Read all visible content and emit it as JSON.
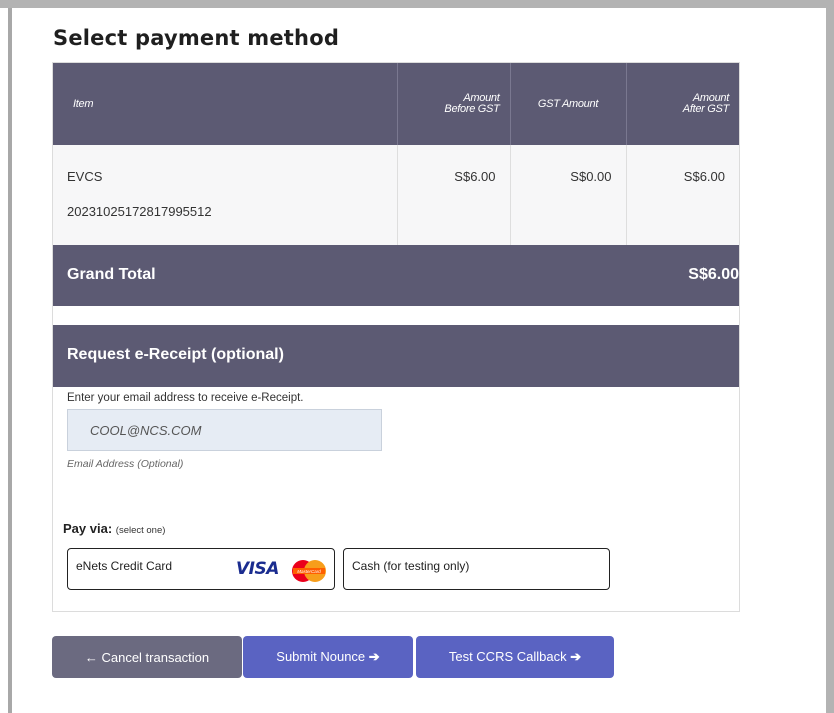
{
  "page": {
    "title": "Select payment method"
  },
  "table": {
    "headers": {
      "item": "Item",
      "before_gst_line1": "Amount",
      "before_gst_line2": "Before GST",
      "gst": "GST Amount",
      "after_gst_line1": "Amount",
      "after_gst_line2": "After GST"
    },
    "rows": [
      {
        "item": "EVCS",
        "reference": "20231025172817995512",
        "before_gst": "S$6.00",
        "gst": "S$0.00",
        "after_gst": "S$6.00"
      }
    ]
  },
  "grand_total": {
    "label": "Grand Total",
    "value": "S$6.00"
  },
  "receipt": {
    "heading": "Request e-Receipt (optional)",
    "help_text": "Enter your email address to receive e-Receipt.",
    "email_value": "COOL@NCS.COM",
    "caption": "Email Address (Optional)"
  },
  "payment": {
    "label": "Pay via:",
    "hint": "(select one)",
    "options": [
      {
        "label": "eNets Credit Card",
        "logo_text": "VISA",
        "mc_text": "MasterCard"
      },
      {
        "label": "Cash (for testing only)"
      }
    ]
  },
  "buttons": {
    "cancel": "Cancel transaction",
    "cancel_icon": "←",
    "submit": "Submit Nounce",
    "test": "Test CCRS Callback",
    "forward_icon": "➔"
  },
  "colors": {
    "header_bg": "#5c5a73",
    "primary_button": "#5a63c2",
    "cancel_button": "#6b6a80",
    "input_bg": "#e6ecf4"
  }
}
